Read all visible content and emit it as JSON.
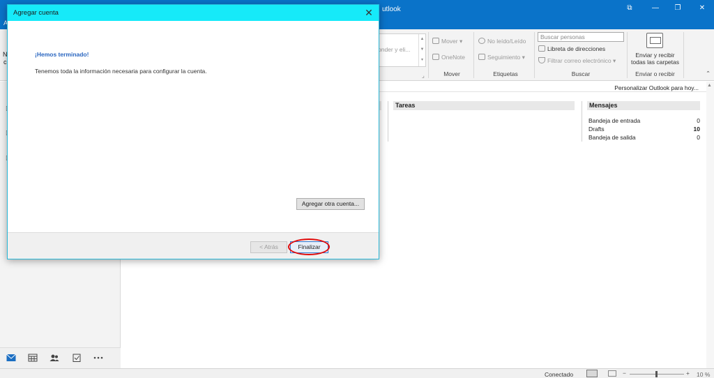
{
  "window": {
    "title_fragment": "utlook",
    "left_letter": "A",
    "buttons": [
      "⧉",
      "—",
      "❐",
      "✕"
    ]
  },
  "ribbon": {
    "quick_steps_text": "onder y eli...",
    "move": {
      "mover": "Mover",
      "onenote": "OneNote",
      "group": "Mover"
    },
    "tags": {
      "unread_read": "No leído/Leído",
      "followup": "Seguimiento",
      "group": "Etiquetas"
    },
    "find": {
      "search_placeholder": "Buscar personas",
      "address_book": "Libreta de direcciones",
      "filter_email": "Filtrar correo electrónico",
      "group": "Buscar"
    },
    "send_receive": {
      "line1": "Enviar y recibir",
      "line2": "todas las carpetas",
      "group": "Enviar o recibir"
    }
  },
  "leftnav": {
    "fragments": [
      "N",
      "c"
    ],
    "nav_icons": [
      "mail-icon",
      "calendar-icon",
      "people-icon",
      "tasks-icon",
      "more-icon"
    ]
  },
  "main": {
    "personalize": "Personalizar Outlook para hoy...",
    "tasks_header": "Tareas",
    "messages_header": "Mensajes",
    "messages": [
      {
        "label": "Bandeja de entrada",
        "count": "0",
        "bold": false
      },
      {
        "label": "Drafts",
        "count": "10",
        "bold": true
      },
      {
        "label": "Bandeja de salida",
        "count": "0",
        "bold": false
      }
    ]
  },
  "statusbar": {
    "connection": "Conectado",
    "zoom_minus": "−",
    "zoom_plus": "+",
    "zoom_value": "10 %"
  },
  "dialog": {
    "title": "Agregar cuenta",
    "close": "✕",
    "heading": "¡Hemos terminado!",
    "message": "Tenemos toda la información necesaria para configurar la cuenta.",
    "add_another": "Agregar otra cuenta...",
    "back": "< Atrás",
    "finish": "Finalizar",
    "highlight_color": "#e10b0b"
  }
}
